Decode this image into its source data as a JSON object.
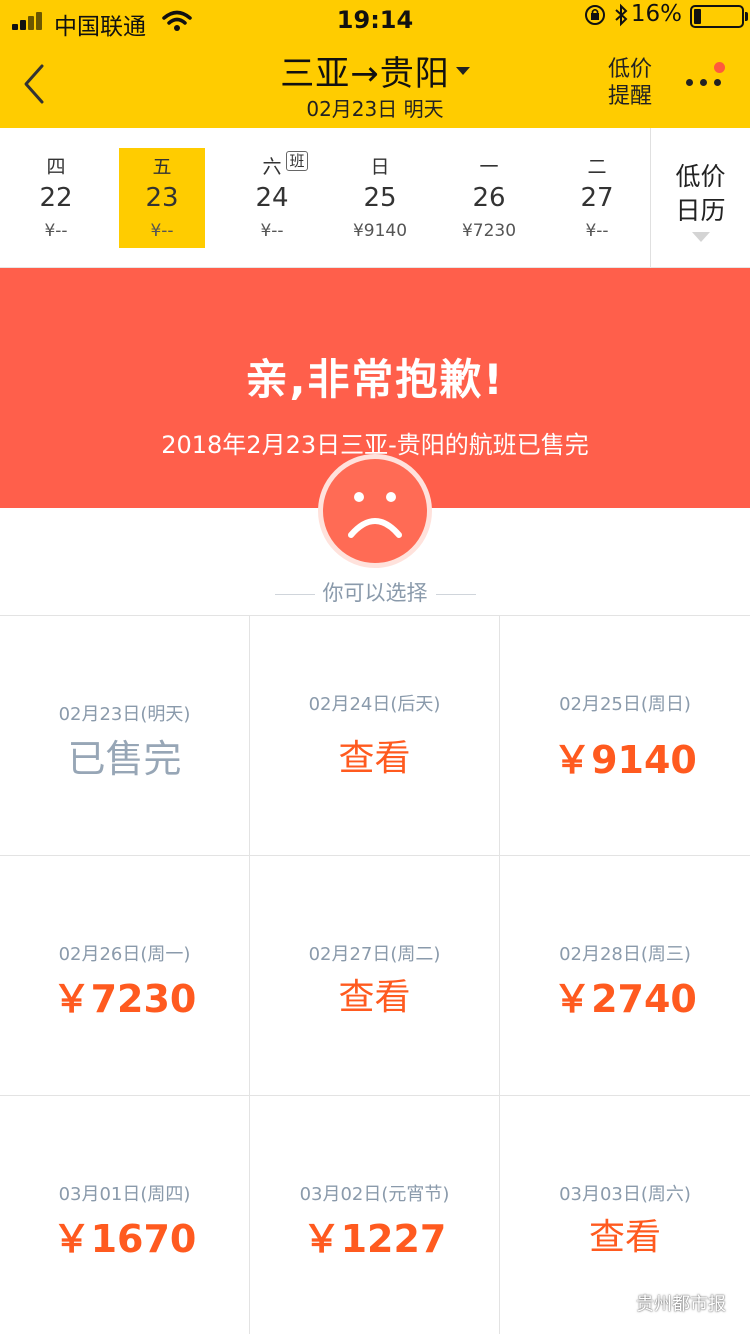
{
  "status_bar": {
    "carrier": "中国联通",
    "time": "19:14",
    "battery": "16%"
  },
  "nav": {
    "title": "三亚→贵阳",
    "subtitle": "02月23日 明天",
    "price_alert": [
      "低价",
      "提醒"
    ]
  },
  "date_strip": {
    "days": [
      {
        "weekday": "四",
        "date": "22",
        "price": "¥--"
      },
      {
        "weekday": "五",
        "date": "23",
        "price": "¥--",
        "selected": true
      },
      {
        "weekday": "六",
        "date": "24",
        "price": "¥--",
        "badge": "班"
      },
      {
        "weekday": "日",
        "date": "25",
        "price": "¥9140"
      },
      {
        "weekday": "一",
        "date": "26",
        "price": "¥7230"
      },
      {
        "weekday": "二",
        "date": "27",
        "price": "¥--"
      }
    ],
    "calendar_label": [
      "低价",
      "日历"
    ]
  },
  "banner": {
    "headline": "亲,非常抱歉!",
    "message": "2018年2月23日三亚-贵阳的航班已售完"
  },
  "choose_label": "你可以选择",
  "options": [
    {
      "date": "02月23日(明天)",
      "value": "已售完"
    },
    {
      "date": "02月24日(后天)",
      "value": "查看"
    },
    {
      "date": "02月25日(周日)",
      "value": "￥9140"
    },
    {
      "date": "02月26日(周一)",
      "value": "￥7230"
    },
    {
      "date": "02月27日(周二)",
      "value": "查看"
    },
    {
      "date": "02月28日(周三)",
      "value": "￥2740"
    },
    {
      "date": "03月01日(周四)",
      "value": "￥1670"
    },
    {
      "date": "03月02日(元宵节)",
      "value": "￥1227"
    },
    {
      "date": "03月03日(周六)",
      "value": "查看"
    }
  ],
  "watermark": "贵州都市报",
  "colors": {
    "header": "#ffcc00",
    "banner": "#ff5f4b",
    "price": "#ff5a1f",
    "muted": "#8a9aab"
  }
}
